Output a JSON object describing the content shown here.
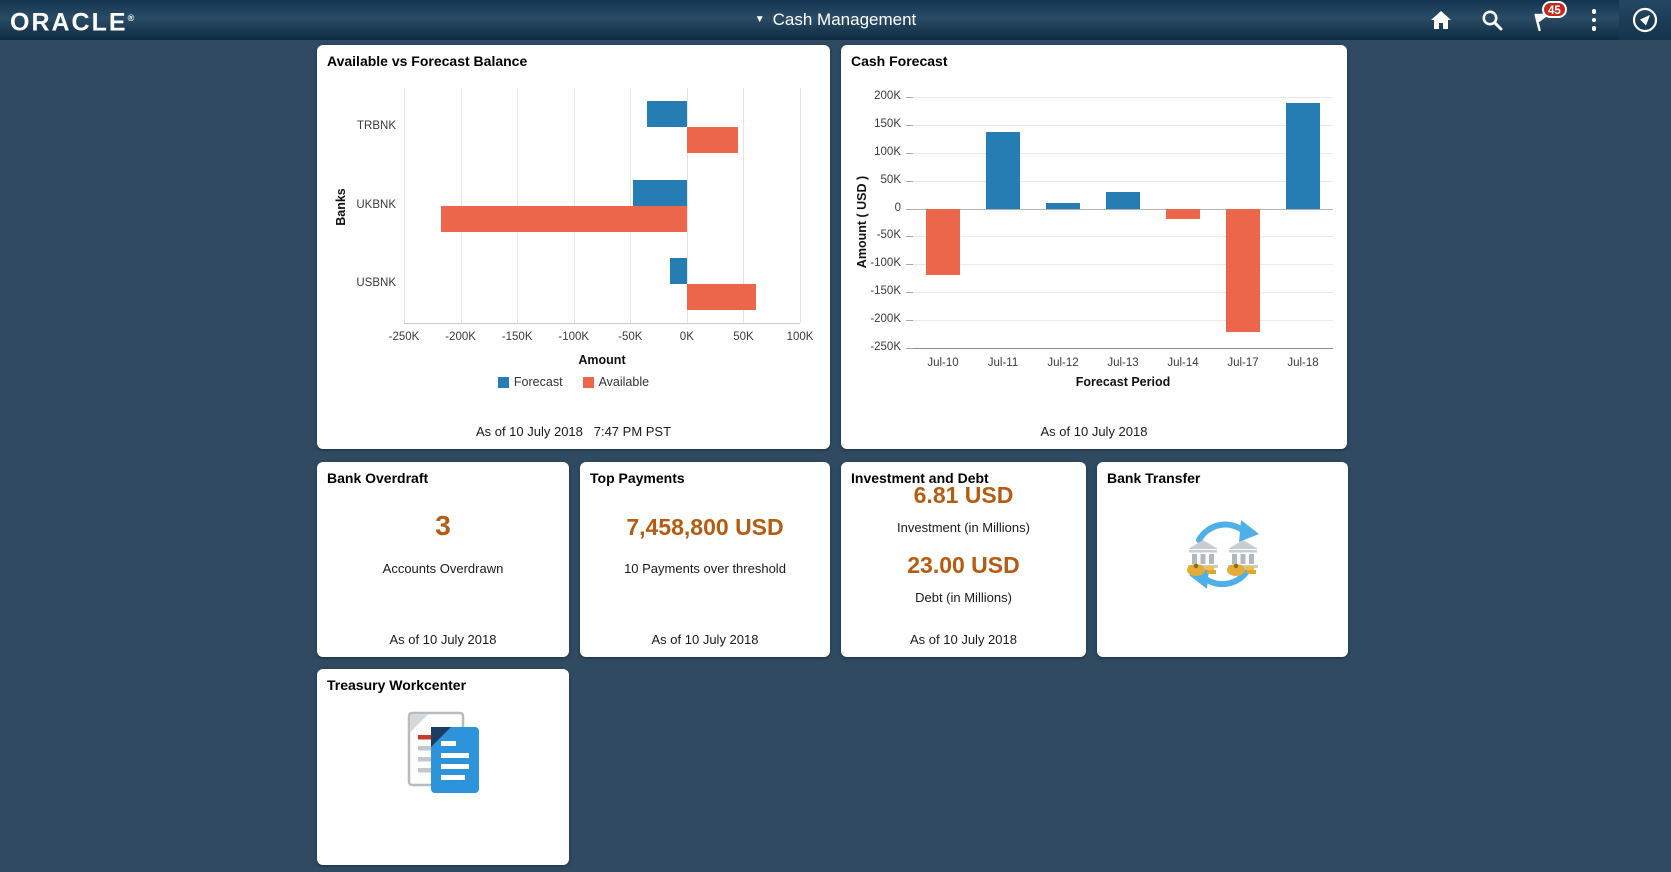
{
  "header": {
    "logo": "ORACLE",
    "logo_registered": "®",
    "dropdown_caret": "▼",
    "title": "Cash Management",
    "notification_badge": "45"
  },
  "tiles": {
    "available_vs_forecast": {
      "title": "Available vs Forecast Balance",
      "as_of": "As of 10 July 2018   7:47 PM PST"
    },
    "cash_forecast": {
      "title": "Cash Forecast",
      "as_of": "As of 10 July 2018"
    },
    "bank_overdraft": {
      "title": "Bank Overdraft",
      "value": "3",
      "label": "Accounts Overdrawn",
      "as_of": "As of 10 July 2018"
    },
    "top_payments": {
      "title": "Top Payments",
      "value": "7,458,800 USD",
      "label": "10 Payments over threshold",
      "as_of": "As of 10 July 2018"
    },
    "investment_and_debt": {
      "title": "Investment and Debt",
      "investment_value": "6.81 USD",
      "investment_label": "Investment (in Millions)",
      "debt_value": "23.00 USD",
      "debt_label": "Debt (in Millions)",
      "as_of": "As of 10 July 2018"
    },
    "bank_transfer": {
      "title": "Bank Transfer"
    },
    "treasury_workcenter": {
      "title": "Treasury Workcenter"
    }
  },
  "colors": {
    "page_background": "#2f4a61",
    "accent_value_text": "#b65c10",
    "chart_blue": "#267db3",
    "chart_orange": "#ec664b",
    "badge_red": "#c5281c"
  },
  "icons": [
    "home-icon",
    "search-icon",
    "notification-flag-icon",
    "kebab-menu-icon",
    "navbar-compass-icon",
    "bank-transfer-icon",
    "treasury-workcenter-icon"
  ],
  "chart_data": [
    {
      "type": "bar",
      "orientation": "horizontal",
      "title": "Available vs Forecast Balance",
      "categories": [
        "TRBNK",
        "UKBNK",
        "USBNK"
      ],
      "series": [
        {
          "name": "Forecast",
          "color": "#267db3",
          "values": [
            -35000,
            -48000,
            -15000
          ]
        },
        {
          "name": "Available",
          "color": "#ec664b",
          "values": [
            45000,
            -217000,
            61000
          ]
        }
      ],
      "xlabel": "Amount",
      "ylabel": "Banks",
      "xlim": [
        -250000,
        100000
      ],
      "xticks": [
        "-250K",
        "-200K",
        "-150K",
        "-100K",
        "-50K",
        "0K",
        "50K",
        "100K"
      ],
      "grid": "vertical",
      "legend_position": "bottom"
    },
    {
      "type": "bar",
      "orientation": "vertical",
      "title": "Cash Forecast",
      "categories": [
        "Jul-10",
        "Jul-11",
        "Jul-12",
        "Jul-13",
        "Jul-14",
        "Jul-17",
        "Jul-18"
      ],
      "values": [
        -120000,
        137000,
        10000,
        30000,
        -18000,
        -222000,
        190000
      ],
      "positive_color": "#267db3",
      "negative_color": "#ec664b",
      "xlabel": "Forecast Period",
      "ylabel": "Amount ( USD )",
      "ylim": [
        -250000,
        200000
      ],
      "yticks": [
        "200K",
        "150K",
        "100K",
        "50K",
        "0",
        "-50K",
        "-100K",
        "-150K",
        "-200K",
        "-250K"
      ],
      "grid": "horizontal",
      "legend_position": "none"
    }
  ]
}
